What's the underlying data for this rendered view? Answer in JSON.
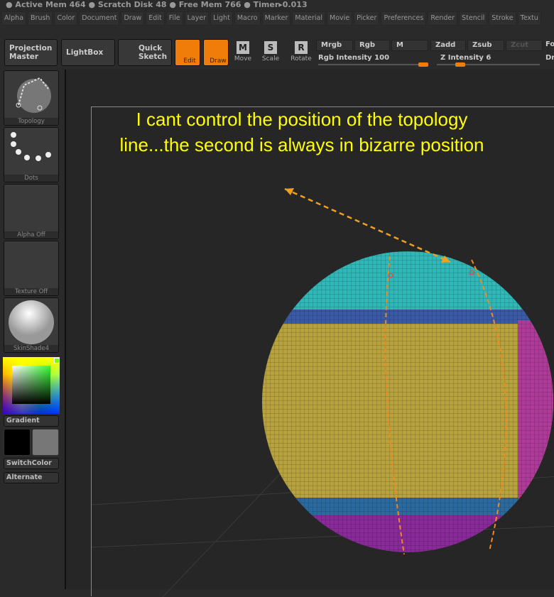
{
  "status_bar": "● Active Mem 464 ● Scratch Disk 48 ● Free Mem 766 ● Timer▸0.013",
  "menus": [
    "Alpha",
    "Brush",
    "Color",
    "Document",
    "Draw",
    "Edit",
    "File",
    "Layer",
    "Light",
    "Macro",
    "Marker",
    "Material",
    "Movie",
    "Picker",
    "Preferences",
    "Render",
    "Stencil",
    "Stroke",
    "Textu"
  ],
  "toolbar": {
    "projection_master": "Projection Master",
    "lightbox": "LightBox",
    "quick_sketch": "Quick Sketch",
    "edit": "Edit",
    "draw": "Draw",
    "move": "Move",
    "scale": "Scale",
    "rotate": "Rotate",
    "move_key": "M",
    "scale_key": "S",
    "rotate_key": "R",
    "mrgb": "Mrgb",
    "rgb": "Rgb",
    "m": "M",
    "zadd": "Zadd",
    "zsub": "Zsub",
    "zcut": "Zcut",
    "rgb_intensity": "Rgb Intensity 100",
    "z_intensity": "Z Intensity 6",
    "fo": "Fo",
    "dr": "Dr",
    "rgb_intensity_value": 100,
    "z_intensity_value": 6,
    "accent": "#f07c0a"
  },
  "sidebar": {
    "brush": "Topology",
    "stroke": "Dots",
    "alpha": "Alpha Off",
    "texture": "Texture Off",
    "material": "SkinShade4",
    "gradient": "Gradient",
    "switch_color": "SwitchColor",
    "alternate": "Alternate"
  },
  "annotation": "I cant control the position of the topology line...the second is always in bizarre position"
}
